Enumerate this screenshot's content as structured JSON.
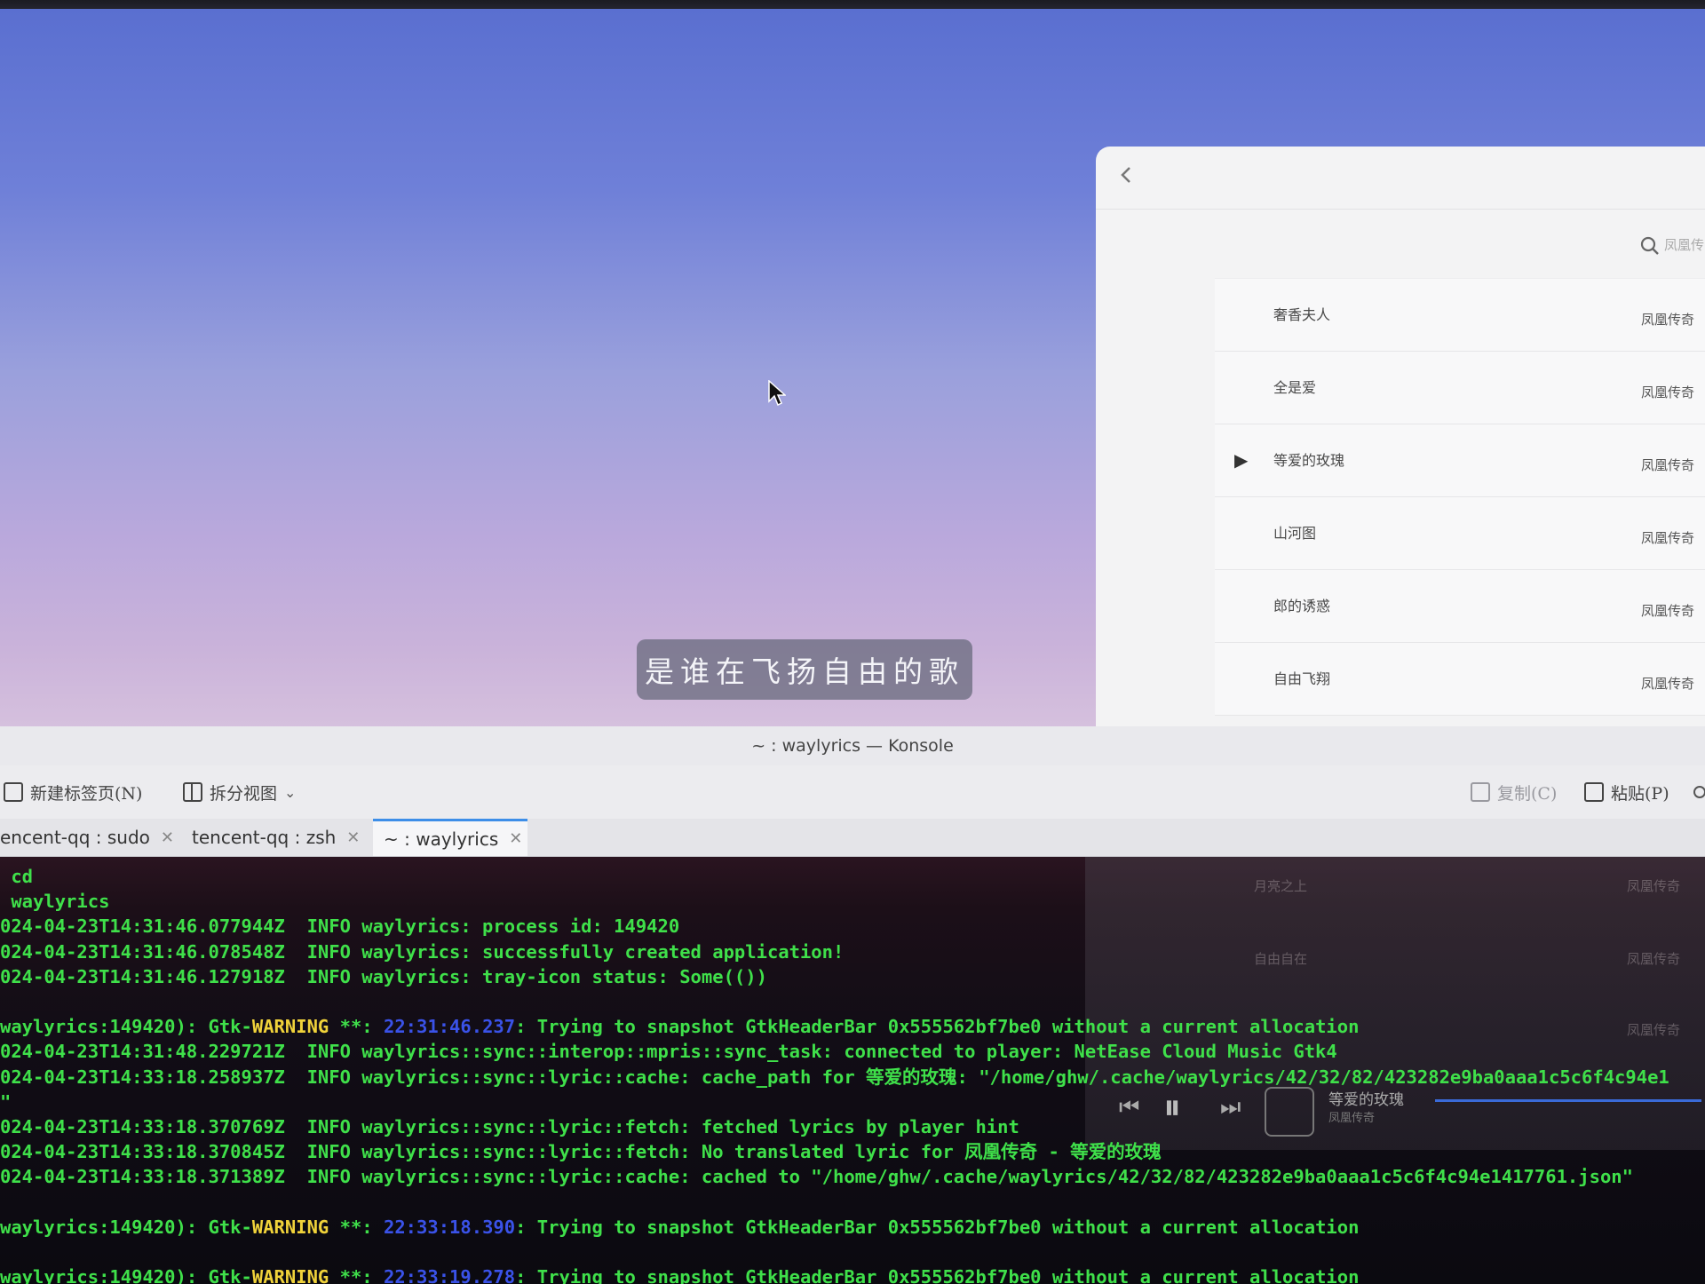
{
  "desktop": {
    "lyric": "是谁在飞扬自由的歌"
  },
  "music_app": {
    "search_placeholder": "凤凰传",
    "songs": [
      {
        "title": "奢香夫人",
        "album": "凤凰传奇",
        "playing": false
      },
      {
        "title": "全是爱",
        "album": "凤凰传奇",
        "playing": false
      },
      {
        "title": "等爱的玫瑰",
        "album": "凤凰传奇",
        "playing": true
      },
      {
        "title": "山河图",
        "album": "凤凰传奇",
        "playing": false
      },
      {
        "title": "郎的诱惑",
        "album": "凤凰传奇",
        "playing": false
      },
      {
        "title": "自由飞翔",
        "album": "凤凰传奇",
        "playing": false
      }
    ],
    "hidden_songs": [
      {
        "title": "月亮之上",
        "album": "凤凰传奇"
      },
      {
        "title": "自由自在",
        "album": "凤凰传奇"
      },
      {
        "title": "",
        "album": "凤凰传奇"
      }
    ],
    "player": {
      "title": "等爱的玫瑰",
      "artist": "凤凰传奇"
    }
  },
  "konsole": {
    "title": "~ : waylyrics — Konsole",
    "toolbar": {
      "new_tab": "新建标签页(N)",
      "split_view": "拆分视图",
      "copy": "复制(C)",
      "paste": "粘贴(P)"
    },
    "tabs": [
      {
        "label": "encent-qq : sudo",
        "active": false
      },
      {
        "label": "tencent-qq : zsh",
        "active": false
      },
      {
        "label": "~ : waylyrics",
        "active": true
      }
    ],
    "lines": [
      [
        {
          "t": " cd",
          "c": ""
        }
      ],
      [
        {
          "t": " waylyrics",
          "c": ""
        }
      ],
      [
        {
          "t": "024-04-23T14:31:46.077944Z  INFO waylyrics: process id: 149420",
          "c": ""
        }
      ],
      [
        {
          "t": "024-04-23T14:31:46.078548Z  INFO waylyrics: successfully created application!",
          "c": ""
        }
      ],
      [
        {
          "t": "024-04-23T14:31:46.127918Z  INFO waylyrics: tray-icon status: Some(())",
          "c": ""
        }
      ],
      [
        {
          "t": "",
          "c": ""
        }
      ],
      [
        {
          "t": "waylyrics:149420): Gtk-",
          "c": ""
        },
        {
          "t": "WARNING",
          "c": "warn"
        },
        {
          "t": " **: ",
          "c": ""
        },
        {
          "t": "22:31:46.237",
          "c": "ts"
        },
        {
          "t": ": Trying to snapshot GtkHeaderBar 0x555562bf7be0 without a current allocation",
          "c": ""
        }
      ],
      [
        {
          "t": "024-04-23T14:31:48.229721Z  INFO waylyrics::sync::interop::mpris::sync_task: connected to player: NetEase Cloud Music Gtk4",
          "c": ""
        }
      ],
      [
        {
          "t": "024-04-23T14:33:18.258937Z  INFO waylyrics::sync::lyric::cache: cache_path for 等爱的玫瑰: \"/home/ghw/.cache/waylyrics/42/32/82/423282e9ba0aaa1c5c6f4c94e1",
          "c": ""
        }
      ],
      [
        {
          "t": "\"",
          "c": ""
        }
      ],
      [
        {
          "t": "024-04-23T14:33:18.370769Z  INFO waylyrics::sync::lyric::fetch: fetched lyrics by player hint",
          "c": ""
        }
      ],
      [
        {
          "t": "024-04-23T14:33:18.370845Z  INFO waylyrics::sync::lyric::fetch: No translated lyric for 凤凰传奇 - 等爱的玫瑰",
          "c": ""
        }
      ],
      [
        {
          "t": "024-04-23T14:33:18.371389Z  INFO waylyrics::sync::lyric::cache: cached to \"/home/ghw/.cache/waylyrics/42/32/82/423282e9ba0aaa1c5c6f4c94e1417761.json\"",
          "c": ""
        }
      ],
      [
        {
          "t": "",
          "c": ""
        }
      ],
      [
        {
          "t": "waylyrics:149420): Gtk-",
          "c": ""
        },
        {
          "t": "WARNING",
          "c": "warn"
        },
        {
          "t": " **: ",
          "c": ""
        },
        {
          "t": "22:33:18.390",
          "c": "ts"
        },
        {
          "t": ": Trying to snapshot GtkHeaderBar 0x555562bf7be0 without a current allocation",
          "c": ""
        }
      ],
      [
        {
          "t": "",
          "c": ""
        }
      ],
      [
        {
          "t": "waylyrics:149420): Gtk-",
          "c": ""
        },
        {
          "t": "WARNING",
          "c": "warn"
        },
        {
          "t": " **: ",
          "c": ""
        },
        {
          "t": "22:33:19.278",
          "c": "ts"
        },
        {
          "t": ": Trying to snapshot GtkHeaderBar 0x555562bf7be0 without a current allocation",
          "c": ""
        }
      ]
    ]
  },
  "colors": {
    "terminal_text": "#3fe04a",
    "warning": "#f0d23a",
    "timestamp": "#3a52e8",
    "active_tab_accent": "#3d8ee8"
  }
}
